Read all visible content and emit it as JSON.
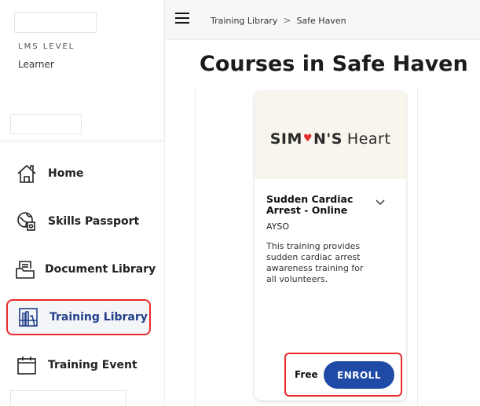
{
  "sidebar": {
    "lms_level_label": "LMS LEVEL",
    "lms_level_value": "Learner",
    "items": [
      {
        "label": "Home",
        "icon": "home-icon"
      },
      {
        "label": "Skills Passport",
        "icon": "passport-icon"
      },
      {
        "label": "Document Library",
        "icon": "document-library-icon"
      },
      {
        "label": "Training Library",
        "icon": "training-library-icon",
        "active": true
      },
      {
        "label": "Training Event",
        "icon": "calendar-icon"
      }
    ]
  },
  "header": {
    "breadcrumb": [
      "Training Library",
      "Safe Haven"
    ],
    "breadcrumb_separator": ">"
  },
  "page": {
    "title": "Courses in Safe Haven"
  },
  "course": {
    "brand_left": "SIM",
    "brand_right": "N'S",
    "brand_heart_word": "Heart",
    "title": "Sudden Cardiac Arrest - Online",
    "provider": "AYSO",
    "description": "This training provides sudden cardiac arrest awareness training for all volunteers.",
    "price": "Free",
    "enroll_label": "ENROLL"
  },
  "colors": {
    "accent_blue": "#1f4aa5",
    "highlight_red": "#ea2a2a",
    "heart_red": "#e62c2c",
    "active_text": "#243e8a"
  }
}
